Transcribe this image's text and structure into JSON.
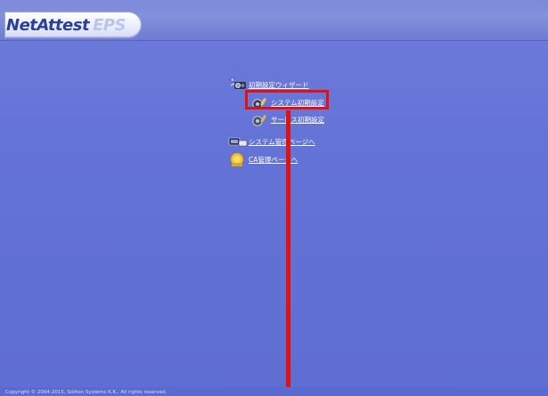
{
  "header": {
    "logo_part1": "NetAttest",
    "logo_part2": "EPS"
  },
  "menu": {
    "wizard": {
      "label": "初期設定ウィザード",
      "icon": "wizard-icon"
    },
    "system_init": {
      "label": "システム初期設定",
      "icon": "system-setup-icon"
    },
    "server_init": {
      "label": "サービス初期設定",
      "icon": "service-setup-icon"
    },
    "system_admin": {
      "label": "システム管理ページへ",
      "icon": "system-admin-icon"
    },
    "ca_admin": {
      "label": "CA管理ページへ",
      "icon": "ca-admin-icon"
    }
  },
  "annotation": {
    "highlight_color": "#e31010",
    "highlight_target": "システム初期設定"
  },
  "footer": {
    "copyright": "Copyright © 2004-2015, Soliton Systems K.K., All rights reserved."
  },
  "colors": {
    "background": "#6370d4",
    "logo_primary": "#2c3f9b",
    "logo_secondary": "#b9c6ec",
    "link": "#ffffff"
  }
}
